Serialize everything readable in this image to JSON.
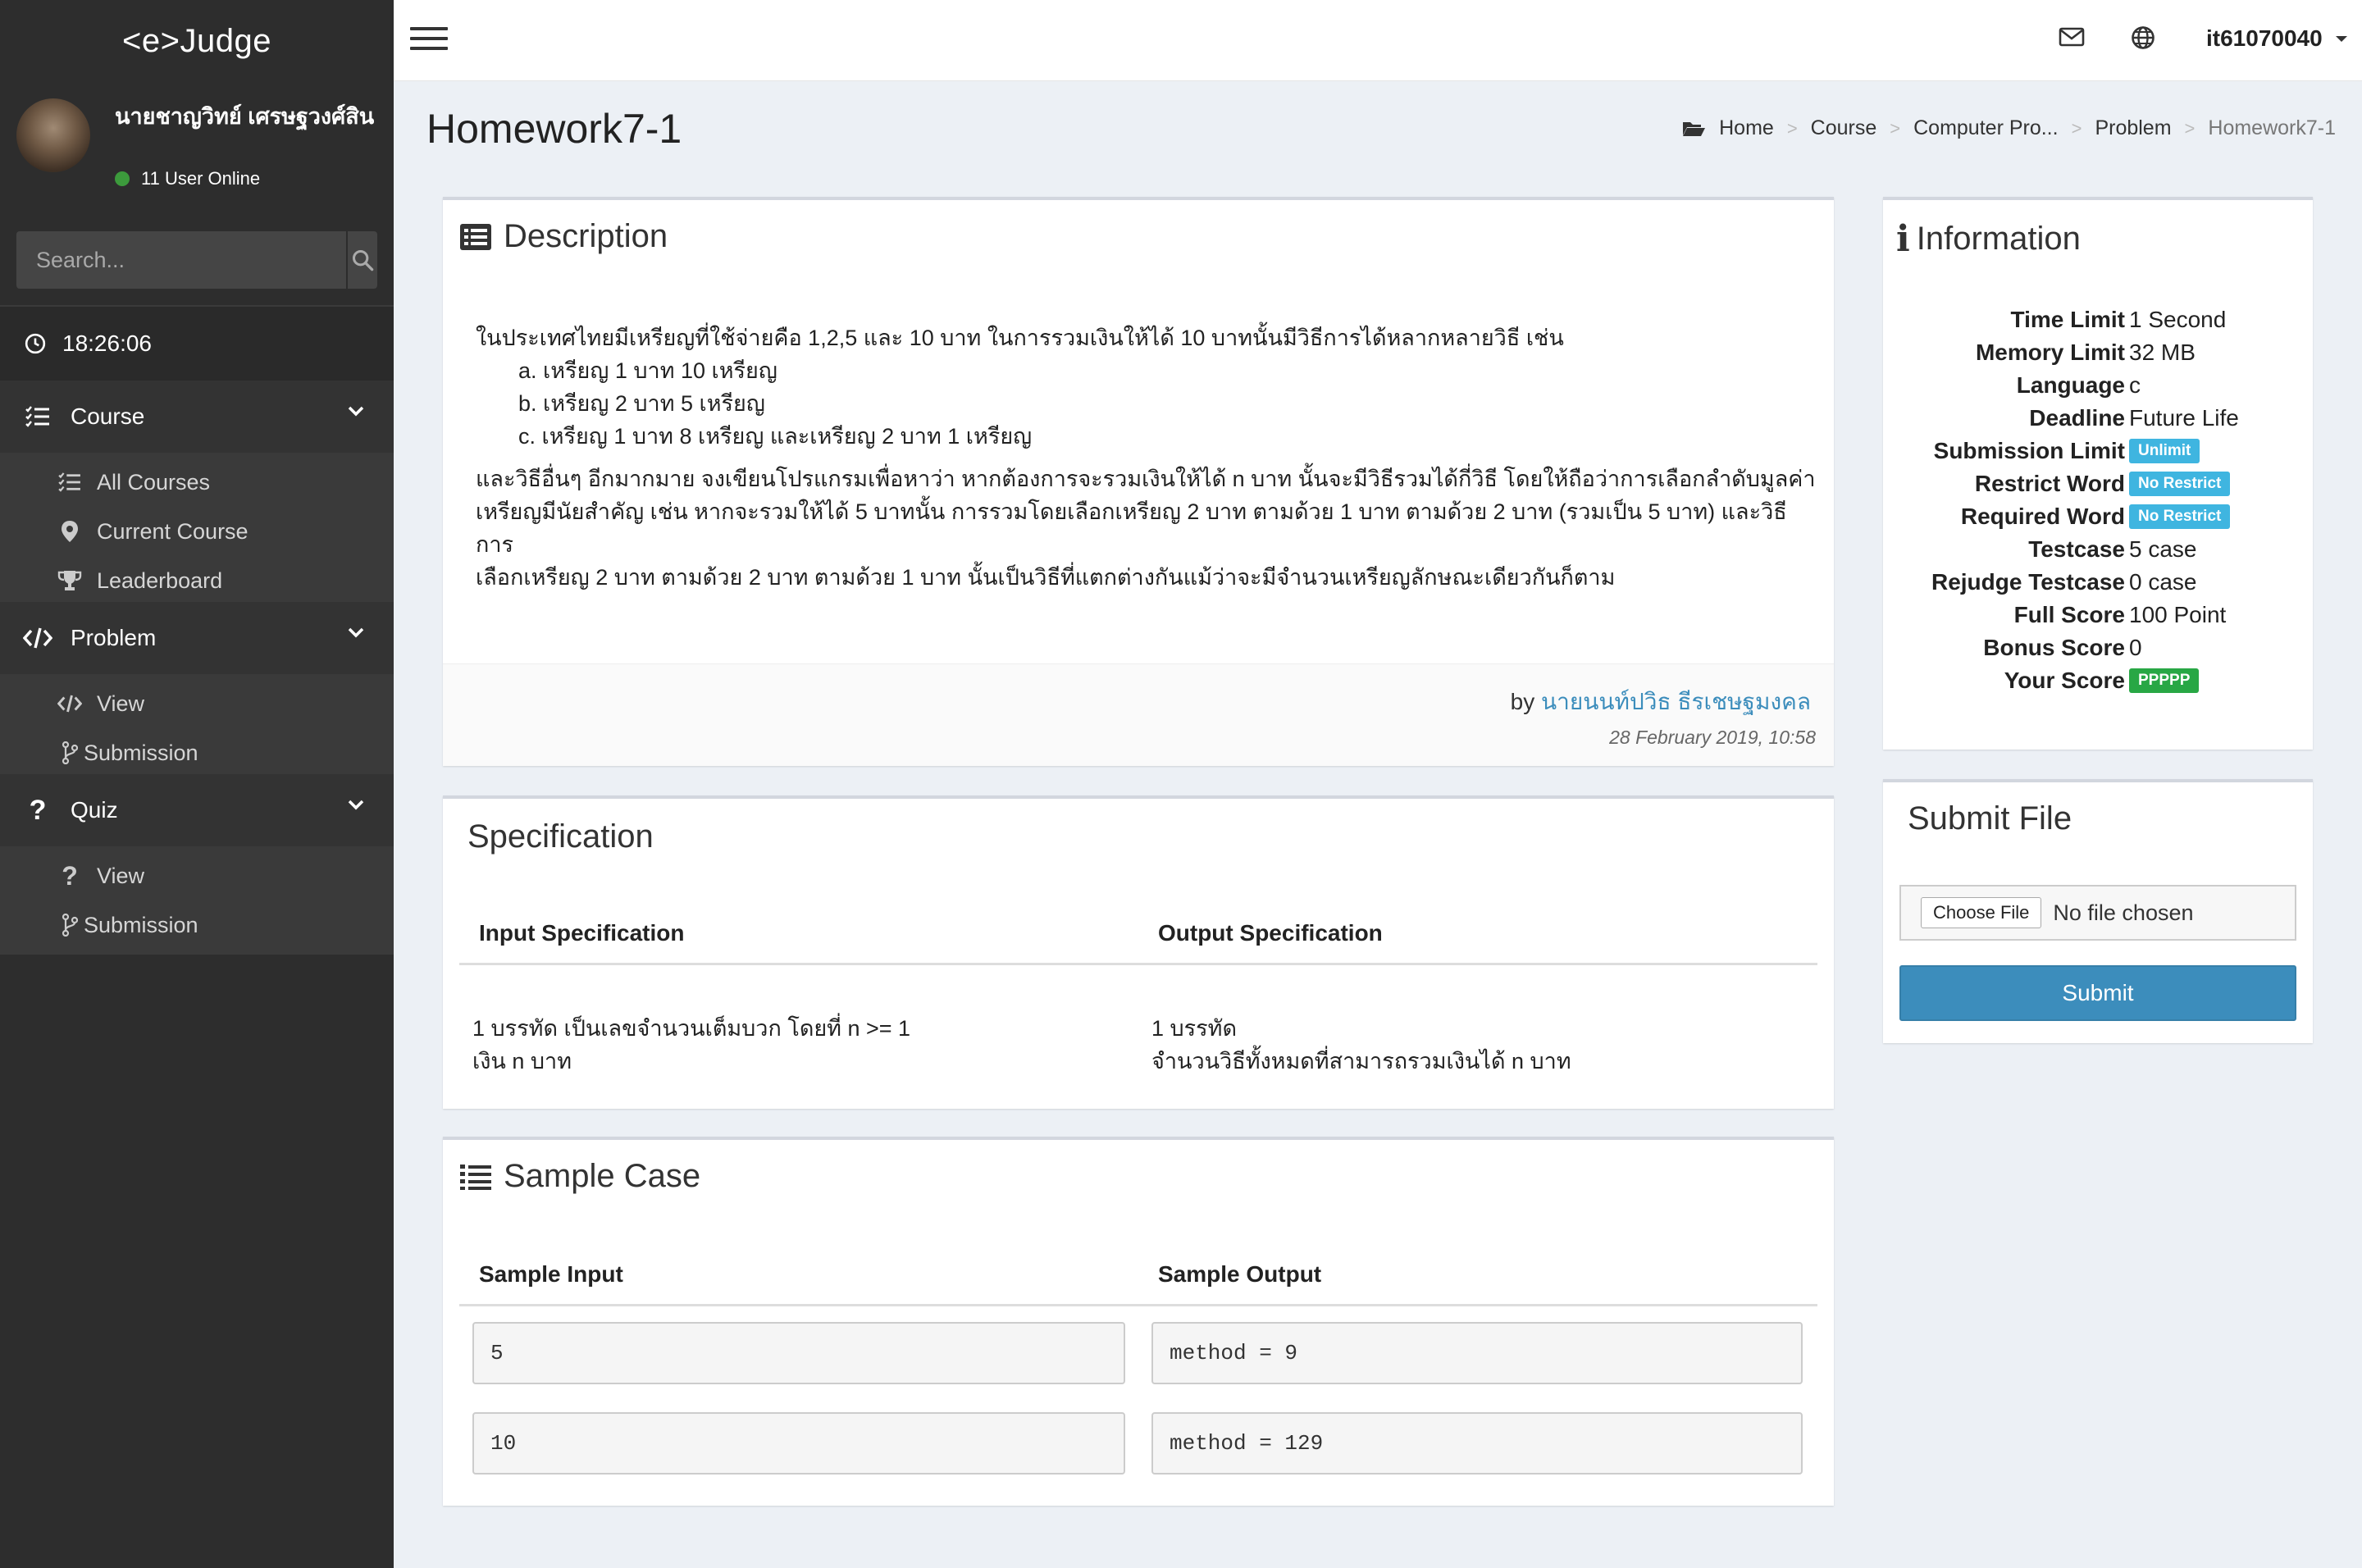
{
  "app": {
    "logo": "<e>Judge"
  },
  "sidebar": {
    "user_name": "นายชาญวิทย์ เศรษฐวงศ์สิน",
    "online_text": "11 User Online",
    "search_placeholder": "Search...",
    "clock": "18:26:06",
    "sections": [
      {
        "label": "Course",
        "items": [
          "All Courses",
          "Current Course",
          "Leaderboard"
        ]
      },
      {
        "label": "Problem",
        "items": [
          "View",
          "Submission"
        ]
      },
      {
        "label": "Quiz",
        "items": [
          "View",
          "Submission"
        ]
      }
    ]
  },
  "header": {
    "username": "it61070040"
  },
  "page": {
    "title": "Homework7-1",
    "breadcrumb": [
      "Home",
      "Course",
      "Computer Pro...",
      "Problem",
      "Homework7-1"
    ]
  },
  "description": {
    "title": "Description",
    "intro": "ในประเทศไทยมีเหรียญที่ใช้จ่ายคือ 1,2,5 และ 10 บาท ในการรวมเงินให้ได้ 10 บาทนั้นมีวิธีการได้หลากหลายวิธี เช่น",
    "list": [
      "a. เหรียญ 1 บาท 10 เหรียญ",
      "b. เหรียญ 2 บาท 5 เหรียญ",
      "c. เหรียญ 1 บาท 8 เหรียญ และเหรียญ 2 บาท 1 เหรียญ"
    ],
    "paragraph_lines": [
      "และวิธีอื่นๆ อีกมากมาย จงเขียนโปรแกรมเพื่อหาว่า หากต้องการจะรวมเงินให้ได้ n บาท นั้นจะมีวิธีรวมได้กี่วิธี โดยให้ถือว่าการเลือกลำดับมูลค่า",
      "เหรียญมีนัยสำคัญ เช่น หากจะรวมให้ได้ 5 บาทนั้น การรวมโดยเลือกเหรียญ 2 บาท ตามด้วย 1 บาท ตามด้วย 2 บาท (รวมเป็น 5 บาท) และวิธีการ",
      "เลือกเหรียญ 2  บาท ตามด้วย 2 บาท ตามด้วย 1 บาท นั้นเป็นวิธีที่แตกต่างกันแม้ว่าจะมีจำนวนเหรียญลักษณะเดียวกันก็ตาม"
    ],
    "by_prefix": "by",
    "author": "นายนนท์ปวิธ ธีรเชษฐมงคล",
    "date": "28 February 2019, 10:58"
  },
  "specification": {
    "title": "Specification",
    "input_header": "Input Specification",
    "output_header": "Output Specification",
    "input_lines": [
      "1 บรรทัด เป็นเลขจำนวนเต็มบวก โดยที่ n >= 1",
      "เงิน n บาท"
    ],
    "output_lines": [
      "1 บรรทัด",
      "จำนวนวิธีทั้งหมดที่สามารถรวมเงินได้ n บาท"
    ]
  },
  "sample": {
    "title": "Sample Case",
    "input_header": "Sample Input",
    "output_header": "Sample Output",
    "cases": [
      {
        "input": "5",
        "output": "method = 9"
      },
      {
        "input": "10",
        "output": "method = 129"
      }
    ]
  },
  "information": {
    "title": "Information",
    "rows": [
      {
        "label": "Time Limit",
        "value": "1 Second",
        "badge": ""
      },
      {
        "label": "Memory Limit",
        "value": "32 MB",
        "badge": ""
      },
      {
        "label": "Language",
        "value": "c",
        "badge": ""
      },
      {
        "label": "Deadline",
        "value": "Future Life",
        "badge": ""
      },
      {
        "label": "Submission Limit",
        "value": "Unlimit",
        "badge": "aqua"
      },
      {
        "label": "Restrict Word",
        "value": "No Restrict",
        "badge": "aqua"
      },
      {
        "label": "Required Word",
        "value": "No Restrict",
        "badge": "aqua"
      },
      {
        "label": "Testcase",
        "value": "5 case",
        "badge": ""
      },
      {
        "label": "Rejudge Testcase",
        "value": "0 case",
        "badge": ""
      },
      {
        "label": "Full Score",
        "value": "100 Point",
        "badge": ""
      },
      {
        "label": "Bonus Score",
        "value": "0",
        "badge": ""
      },
      {
        "label": "Your Score",
        "value": "PPPPP",
        "badge": "green"
      }
    ]
  },
  "submit": {
    "title": "Submit File",
    "choose_label": "Choose File",
    "no_file": "No file chosen",
    "button": "Submit"
  },
  "colors": {
    "sidebar_bg": "#2d2d2d",
    "accent": "#3c8dbc",
    "badge_aqua": "#3fb5e0",
    "badge_green": "#28a745"
  },
  "icons": [
    "bars-icon",
    "envelope-icon",
    "globe-icon",
    "search-icon",
    "clock-icon",
    "list-check-icon",
    "map-marker-icon",
    "trophy-icon",
    "code-icon",
    "code-branch-icon",
    "question-icon",
    "folder-open-icon",
    "list-alt-icon",
    "info-icon",
    "list-ol-icon"
  ]
}
